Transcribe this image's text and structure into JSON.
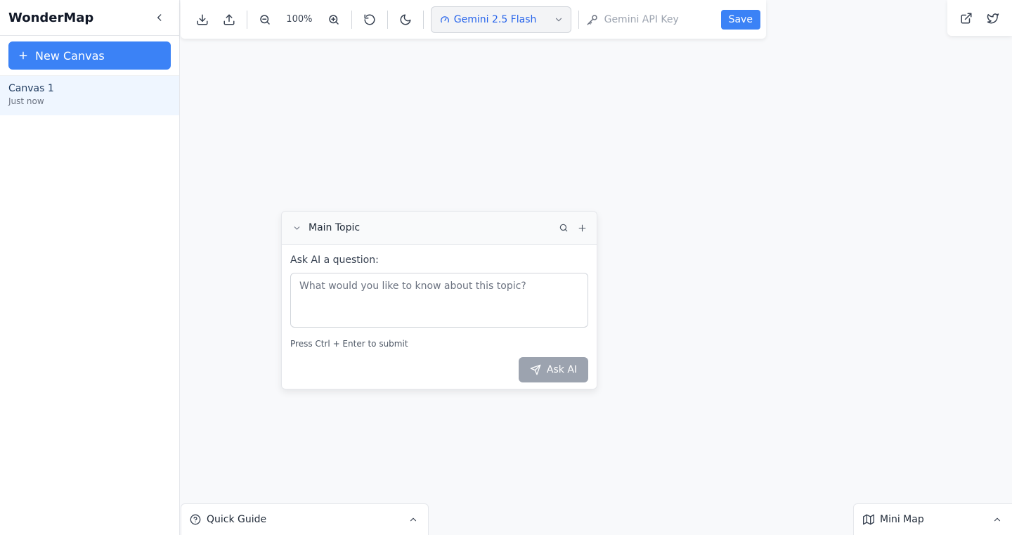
{
  "sidebar": {
    "app_title": "WonderMap",
    "collapse_icon": "chevron-left-icon",
    "new_canvas_label": "New Canvas",
    "canvases": [
      {
        "name": "Canvas 1",
        "time": "Just now"
      }
    ]
  },
  "toolbar": {
    "zoom": "100%",
    "model": "Gemini 2.5 Flash",
    "api_key_placeholder": "Gemini API Key",
    "api_key_value": "",
    "save_label": "Save"
  },
  "node": {
    "title": "Main Topic",
    "ask_label": "Ask AI a question:",
    "question_placeholder": "What would you like to know about this topic?",
    "hint": "Press Ctrl + Enter to submit",
    "ask_button_label": "Ask AI"
  },
  "bottom": {
    "quick_guide_label": "Quick Guide",
    "mini_map_label": "Mini Map"
  },
  "colors": {
    "accent": "#3b82f6",
    "model_text": "#2563eb",
    "disabled_button": "#9ca3af",
    "canvas_background": "#f8f9fb",
    "selected_item": "#eff6ff"
  }
}
